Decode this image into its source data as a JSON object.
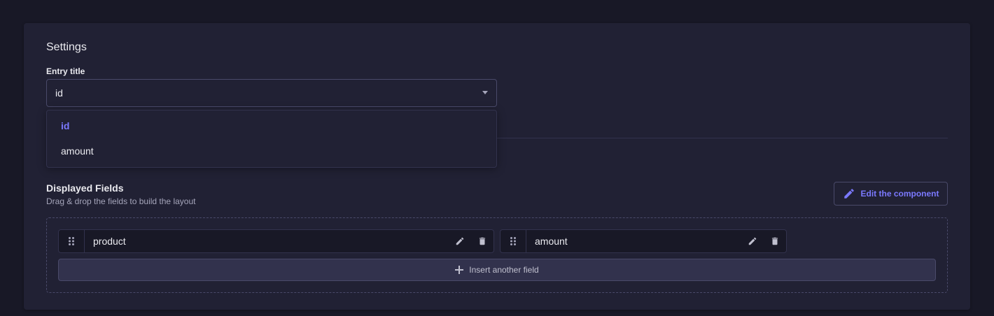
{
  "settings": {
    "title": "Settings",
    "entry_title_label": "Entry title",
    "entry_title_value": "id",
    "options": [
      "id",
      "amount"
    ],
    "selected_option": "id"
  },
  "displayed_fields": {
    "title": "Displayed Fields",
    "subtitle": "Drag & drop the fields to build the layout",
    "edit_button": "Edit the component",
    "fields": [
      {
        "name": "product"
      },
      {
        "name": "amount"
      }
    ],
    "insert_button": "Insert another field"
  },
  "colors": {
    "background": "#181826",
    "card": "#212134",
    "accent": "#7b79ff",
    "border": "#4a4a6a"
  },
  "icons": {
    "select": "chevron-down-icon",
    "edit_component": "pencil-icon",
    "drag": "drag-handle-icon",
    "field_edit": "pencil-icon",
    "field_delete": "trash-icon",
    "insert": "plus-icon"
  }
}
